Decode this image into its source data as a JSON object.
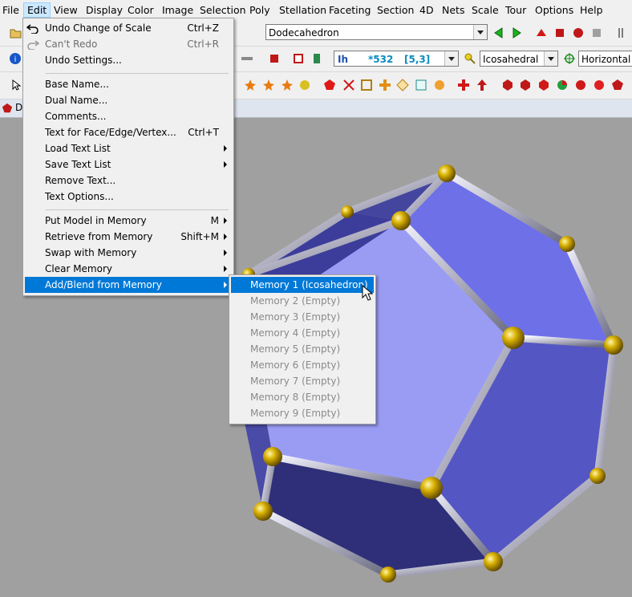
{
  "menubar": [
    "File",
    "Edit",
    "View",
    "Display",
    "Color",
    "Image",
    "Selection",
    "Poly",
    "Stellation",
    "Faceting",
    "Section",
    "4D",
    "Nets",
    "Scale",
    "Tour",
    "Options",
    "Help"
  ],
  "toolbar": {
    "model_name": "Dodecahedron",
    "symmetry_label": "Ih",
    "symmetry_code": "*532",
    "symmetry_schlafli": "[5,3]",
    "group_select": "Icosahedral",
    "orientation_select": "Horizontal Re"
  },
  "tab": {
    "label": "D"
  },
  "edit_menu": {
    "items": [
      {
        "label": "Undo Change of Scale",
        "shortcut": "Ctrl+Z"
      },
      {
        "label": "Can't Redo",
        "shortcut": "Ctrl+R"
      },
      {
        "label": "Undo Settings..."
      },
      {
        "label": "Base Name..."
      },
      {
        "label": "Dual Name..."
      },
      {
        "label": "Comments..."
      },
      {
        "label": "Text for Face/Edge/Vertex...",
        "shortcut": "Ctrl+T"
      },
      {
        "label": "Load Text List"
      },
      {
        "label": "Save Text List"
      },
      {
        "label": "Remove Text..."
      },
      {
        "label": "Text Options..."
      },
      {
        "label": "Put Model in Memory",
        "shortcut": "M"
      },
      {
        "label": "Retrieve from Memory",
        "shortcut": "Shift+M"
      },
      {
        "label": "Swap with Memory"
      },
      {
        "label": "Clear Memory"
      },
      {
        "label": "Add/Blend from Memory"
      }
    ]
  },
  "memory_submenu": {
    "items": [
      {
        "label": "Memory 1 (Icosahedron)"
      },
      {
        "label": "Memory 2 (Empty)"
      },
      {
        "label": "Memory 3 (Empty)"
      },
      {
        "label": "Memory 4 (Empty)"
      },
      {
        "label": "Memory 5 (Empty)"
      },
      {
        "label": "Memory 6 (Empty)"
      },
      {
        "label": "Memory 7 (Empty)"
      },
      {
        "label": "Memory 8 (Empty)"
      },
      {
        "label": "Memory 9 (Empty)"
      }
    ]
  },
  "colors": {
    "highlight": "#0078d7",
    "face_light": "#8e90f0",
    "face_dark": "#3a3b8a",
    "vertex_gold": "#c9a400"
  }
}
